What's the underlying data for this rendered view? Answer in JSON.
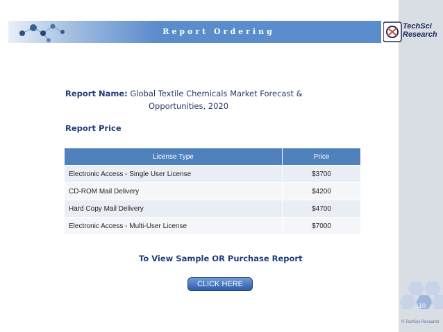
{
  "header": {
    "title": "Report Ordering"
  },
  "logo": {
    "line1": "TechSci",
    "line2": "Research"
  },
  "report": {
    "name_label": "Report Name:",
    "name_line1": "Global Textile Chemicals Market Forecast &",
    "name_line2": "Opportunities, 2020",
    "price_heading": "Report Price"
  },
  "table": {
    "headers": [
      "License Type",
      "Price"
    ],
    "rows": [
      {
        "type": "Electronic Access - Single User License",
        "price": "$3700"
      },
      {
        "type": "CD-ROM Mail Delivery",
        "price": "$4200"
      },
      {
        "type": "Hard Copy Mail Delivery",
        "price": "$4700"
      },
      {
        "type": "Electronic Access - Multi-User License",
        "price": "$7000"
      }
    ]
  },
  "cta": {
    "text": "To View Sample OR Purchase Report",
    "button": "CLICK HERE"
  },
  "footer": {
    "page_number": "10",
    "copyright": "© TechSci Research"
  },
  "colors": {
    "accent": "#4f81bd",
    "heading": "#1f3d78",
    "band": "#d9dde4"
  }
}
